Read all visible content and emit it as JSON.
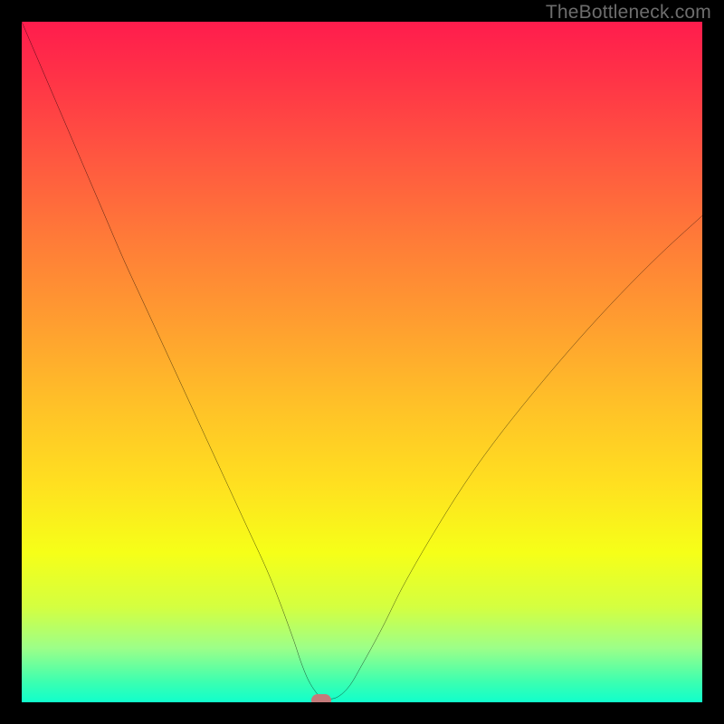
{
  "watermark": "TheBottleneck.com",
  "chart_data": {
    "type": "line",
    "title": "",
    "xlabel": "",
    "ylabel": "",
    "xlim": [
      0,
      100
    ],
    "ylim": [
      0,
      100
    ],
    "grid": false,
    "legend": false,
    "background_gradient": {
      "direction": "vertical",
      "stops": [
        {
          "pos": 0,
          "color": "#ff1c4d"
        },
        {
          "pos": 20,
          "color": "#ff5740"
        },
        {
          "pos": 44,
          "color": "#ff9d30"
        },
        {
          "pos": 68,
          "color": "#ffe020"
        },
        {
          "pos": 86,
          "color": "#d4ff40"
        },
        {
          "pos": 100,
          "color": "#10ffcc"
        }
      ]
    },
    "series": [
      {
        "name": "bottleneck-curve",
        "color": "#000000",
        "x": [
          0,
          3,
          6,
          9,
          12,
          15,
          18,
          21,
          24,
          27,
          30,
          33,
          36,
          38,
          40,
          41,
          42,
          43,
          44,
          46,
          48,
          50,
          53,
          56,
          60,
          65,
          70,
          76,
          82,
          88,
          94,
          100
        ],
        "y": [
          100,
          93,
          86,
          79,
          72,
          65,
          58.5,
          52,
          45.5,
          39,
          32.5,
          26,
          19.5,
          14.5,
          9,
          6,
          3.5,
          1.8,
          0.8,
          0.6,
          2.2,
          5.5,
          11,
          17,
          24,
          32,
          39,
          46.5,
          53.5,
          60,
          66,
          71.5
        ]
      }
    ],
    "marker": {
      "name": "optimal-point",
      "x": 44,
      "y": 0.3,
      "color": "#c47a7a"
    }
  }
}
